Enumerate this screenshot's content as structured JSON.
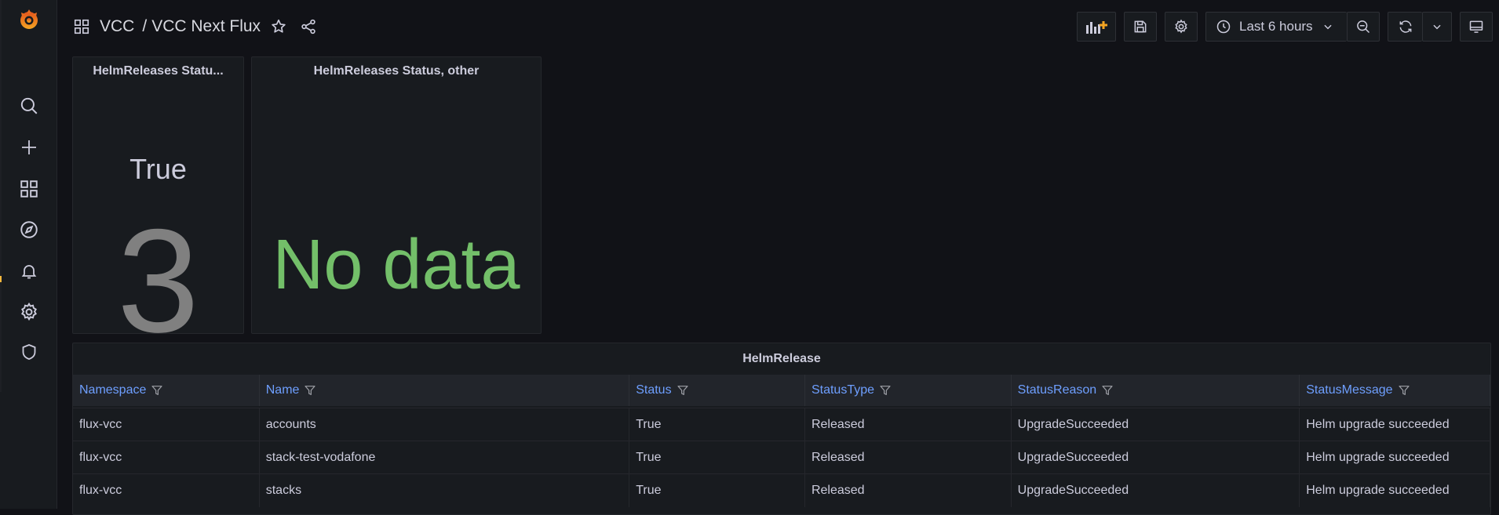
{
  "breadcrumb": {
    "folder": "VCC",
    "separator": "/",
    "dashboard": "VCC Next Flux"
  },
  "toolbar": {
    "time_range": "Last 6 hours"
  },
  "panels": [
    {
      "title": "HelmReleases Statu...",
      "label": "True",
      "value": "3"
    },
    {
      "title": "HelmReleases Status, other",
      "no_data": "No data"
    }
  ],
  "table": {
    "title": "HelmRelease",
    "columns": [
      "Namespace",
      "Name",
      "Status",
      "StatusType",
      "StatusReason",
      "StatusMessage"
    ],
    "rows": [
      [
        "flux-vcc",
        "accounts",
        "True",
        "Released",
        "UpgradeSucceeded",
        "Helm upgrade succeeded"
      ],
      [
        "flux-vcc",
        "stack-test-vodafone",
        "True",
        "Released",
        "UpgradeSucceeded",
        "Helm upgrade succeeded"
      ],
      [
        "flux-vcc",
        "stacks",
        "True",
        "Released",
        "UpgradeSucceeded",
        "Helm upgrade succeeded"
      ]
    ]
  },
  "colors": {
    "accent": "#f5b73d",
    "link": "#6e9fff",
    "no_data": "#73bf69",
    "stat_value": "#808080"
  },
  "icons": {
    "sidebar": [
      "grafana-logo-icon",
      "search-icon",
      "plus-icon",
      "dashboards-icon",
      "explore-icon",
      "bell-icon",
      "gear-icon",
      "shield-icon"
    ],
    "toolbar": [
      "apps-icon",
      "star-icon",
      "share-icon",
      "add-panel-icon",
      "save-icon",
      "gear-icon",
      "clock-icon",
      "chevron-down-icon",
      "zoom-out-icon",
      "refresh-icon",
      "chevron-down-icon",
      "monitor-icon"
    ]
  }
}
